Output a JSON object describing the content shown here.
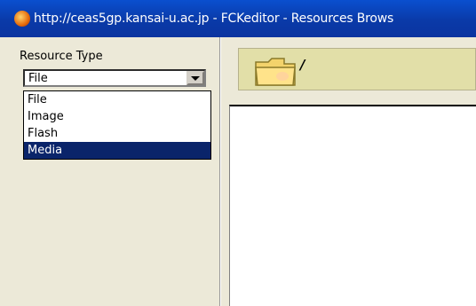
{
  "window": {
    "title": "http://ceas5gp.kansai-u.ac.jp - FCKeditor - Resources Brows"
  },
  "resource_type": {
    "label": "Resource Type",
    "selected_value": "File",
    "options": [
      "File",
      "Image",
      "Flash",
      "Media"
    ],
    "highlighted_option": "Media"
  },
  "path_bar": {
    "current_path": "/"
  },
  "colors": {
    "titlebar": "#0a3aa8",
    "highlight": "#0a246a",
    "path_bar_bg": "#e2dfa8",
    "pane_bg": "#ece9d8"
  }
}
